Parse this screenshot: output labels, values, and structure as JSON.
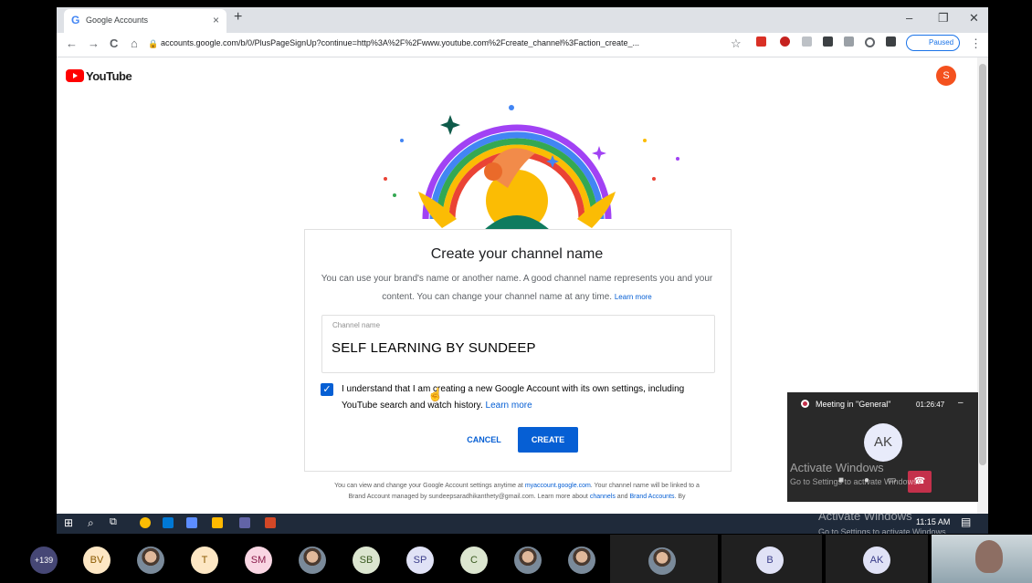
{
  "browser": {
    "tab_title": "Google Accounts",
    "tab_favicon": "G",
    "tab_close": "×",
    "new_tab": "+",
    "url": "accounts.google.com/b/0/PlusPageSignUp?continue=http%3A%2F%2Fwww.youtube.com%2Fcreate_channel%3Faction_create_...",
    "paused_label": "Paused",
    "window_controls": {
      "minimize": "–",
      "restore": "❐",
      "close": "✕"
    },
    "nav": {
      "back": "←",
      "forward": "→",
      "reload": "C",
      "home": "⌂",
      "star": "☆",
      "menu": "⋮"
    }
  },
  "youtube": {
    "logo_text": "YouTube",
    "avatar_letter": "S",
    "accent": "#ff0000",
    "avatar_color": "#f4511e"
  },
  "dialog": {
    "title": "Create your channel name",
    "description": "You can use your brand's name or another name. A good channel name represents you and your content. You can change your channel name at any time.",
    "learn_more": "Learn more",
    "field_label": "Channel name",
    "field_value": "SELF LEARNING BY SUNDEEP",
    "checkbox_checked": true,
    "checkbox_text": "I understand that I am creating a new Google Account with its own settings, including YouTube search and watch history.",
    "checkbox_learn_more": "Learn more",
    "cancel_label": "CANCEL",
    "create_label": "CREATE",
    "primary_color": "#065fd4"
  },
  "footer": {
    "text1": "You can view and change your Google Account settings anytime at",
    "link1": "myaccount.google.com",
    "text2": ". Your channel name will be linked to a Brand Account managed by sundeepsaradhikanthety@gmail.com. Learn more about",
    "link2": "channels",
    "text3": "and",
    "link3": "Brand Accounts",
    "text4": ". By"
  },
  "meeting": {
    "title": "Meeting in \"General\"",
    "time": "01:26:47",
    "minimize": "–",
    "avatar": "AK",
    "hangup_icon": "☎"
  },
  "watermark": {
    "line1": "Activate Windows",
    "line2": "Go to Settings to activate Windows."
  },
  "taskbar": {
    "time": "11:15 AM"
  },
  "participants": [
    {
      "initials": "+139",
      "bg": "#464775",
      "fg": "#ffffff"
    },
    {
      "initials": "BV",
      "bg": "#fde7c4",
      "fg": "#8a5a00"
    },
    {
      "initials": "",
      "photo": true
    },
    {
      "initials": "T",
      "bg": "#fde7c4",
      "fg": "#8a5a00"
    },
    {
      "initials": "SM",
      "bg": "#f9d6e3",
      "fg": "#8a1c4a"
    },
    {
      "initials": "",
      "photo": true
    },
    {
      "initials": "SB",
      "bg": "#dce6d0",
      "fg": "#3a5a20"
    },
    {
      "initials": "SP",
      "bg": "#e0e2f6",
      "fg": "#3a3d8a"
    },
    {
      "initials": "C",
      "bg": "#dce6d0",
      "fg": "#3a5a20"
    },
    {
      "initials": "",
      "photo": true
    },
    {
      "initials": "",
      "photo": true
    }
  ],
  "participant_tiles": [
    {
      "initials": "B",
      "bg": "#e0e2f6",
      "fg": "#3a3d8a"
    },
    {
      "initials": "AK",
      "bg": "#e0e2f6",
      "fg": "#3a3d8a"
    }
  ]
}
